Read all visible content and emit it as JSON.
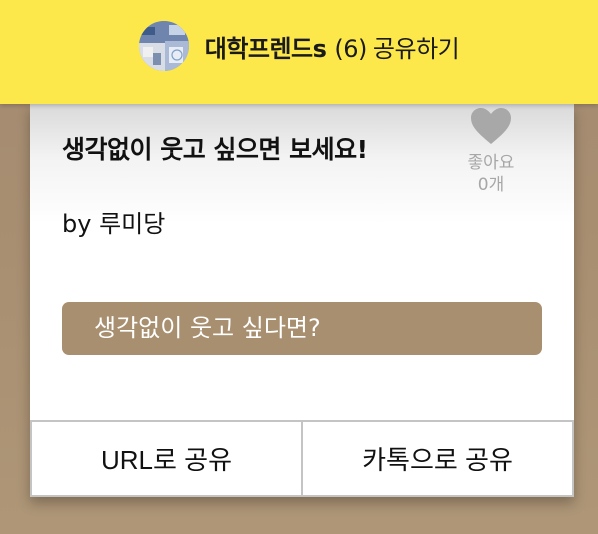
{
  "header": {
    "room_name": "대학프렌드s",
    "member_count": "(6)",
    "action": "공유하기"
  },
  "post": {
    "title": "생각없이 웃고 싶으면 보세요!",
    "author": "by 루미당",
    "summary": "생각없이 웃고 싶다면?",
    "like_label": "좋아요",
    "like_count": "0개"
  },
  "buttons": {
    "url_share": "URL로 공유",
    "kakao_share": "카톡으로 공유"
  },
  "colors": {
    "header_bg": "#fde84b",
    "summary_bg": "#a88f70",
    "backdrop": "#a88f74"
  }
}
